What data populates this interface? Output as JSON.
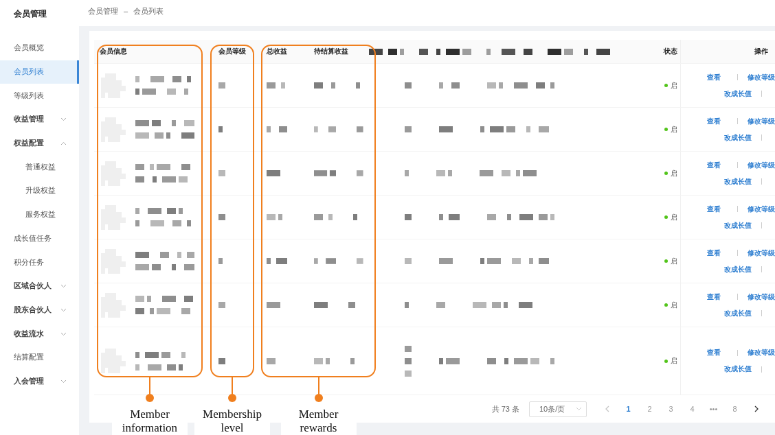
{
  "app": {
    "title": "会员管理"
  },
  "sidebar": {
    "items": [
      {
        "label": "会员概览",
        "selected": false
      },
      {
        "label": "会员列表",
        "selected": true
      },
      {
        "label": "等级列表",
        "selected": false
      },
      {
        "label": "收益管理",
        "selected": false,
        "expanded": false
      },
      {
        "label": "权益配置",
        "selected": false,
        "expanded": true,
        "children": [
          {
            "label": "普通权益",
            "selected": false
          },
          {
            "label": "升级权益",
            "selected": false
          },
          {
            "label": "服务权益",
            "selected": false
          }
        ]
      },
      {
        "label": "成长值任务",
        "selected": false
      },
      {
        "label": "积分任务",
        "selected": false
      },
      {
        "label": "区域合伙人",
        "selected": false,
        "expanded": false
      },
      {
        "label": "股东合伙人",
        "selected": false,
        "expanded": false
      },
      {
        "label": "收益流水",
        "selected": false,
        "expanded": false
      },
      {
        "label": "结算配置",
        "selected": false
      },
      {
        "label": "入会管理",
        "selected": false,
        "expanded": false
      }
    ]
  },
  "breadcrumb": {
    "items": [
      "会员管理",
      "会员列表"
    ],
    "separator": "–"
  },
  "table": {
    "columns": [
      {
        "label": "会员信息"
      },
      {
        "label": "会员等级"
      },
      {
        "label": "总收益"
      },
      {
        "label": "待结算收益"
      },
      {
        "label": "状态"
      },
      {
        "label": "操作"
      }
    ],
    "rows": [
      {
        "status": "启",
        "enabled": true,
        "actions": [
          {
            "label": "查看"
          },
          {
            "label": "修改等级"
          },
          {
            "label": "改成长值"
          }
        ]
      },
      {
        "status": "启",
        "enabled": true,
        "actions": [
          {
            "label": "查看"
          },
          {
            "label": "修改等级"
          },
          {
            "label": "改成长值"
          }
        ]
      },
      {
        "status": "启",
        "enabled": true,
        "actions": [
          {
            "label": "查看"
          },
          {
            "label": "修改等级"
          },
          {
            "label": "改成长值"
          }
        ]
      },
      {
        "status": "启",
        "enabled": true,
        "actions": [
          {
            "label": "查看"
          },
          {
            "label": "修改等级"
          },
          {
            "label": "改成长值"
          }
        ]
      },
      {
        "status": "启",
        "enabled": true,
        "actions": [
          {
            "label": "查看"
          },
          {
            "label": "修改等级"
          },
          {
            "label": "改成长值"
          }
        ]
      },
      {
        "status": "启",
        "enabled": true,
        "actions": [
          {
            "label": "查看"
          },
          {
            "label": "修改等级"
          },
          {
            "label": "改成长值"
          }
        ]
      },
      {
        "status": "启",
        "enabled": true,
        "actions": [
          {
            "label": "查看"
          },
          {
            "label": "修改等级"
          },
          {
            "label": "改成长值"
          }
        ]
      }
    ]
  },
  "pagination": {
    "total": "共 73 条",
    "page_size": "10条/页",
    "prev": {
      "disabled": true
    },
    "next": {
      "disabled": false
    },
    "pages": [
      {
        "label": "1",
        "selected": true
      },
      {
        "label": "2",
        "selected": false
      },
      {
        "label": "3",
        "selected": false
      },
      {
        "label": "4",
        "selected": false
      },
      {
        "label": "•••",
        "selected": false
      },
      {
        "label": "8",
        "selected": false
      }
    ]
  },
  "annotations": [
    {
      "label": "Member information"
    },
    {
      "label": "Membership level"
    },
    {
      "label": "Member rewards"
    }
  ]
}
